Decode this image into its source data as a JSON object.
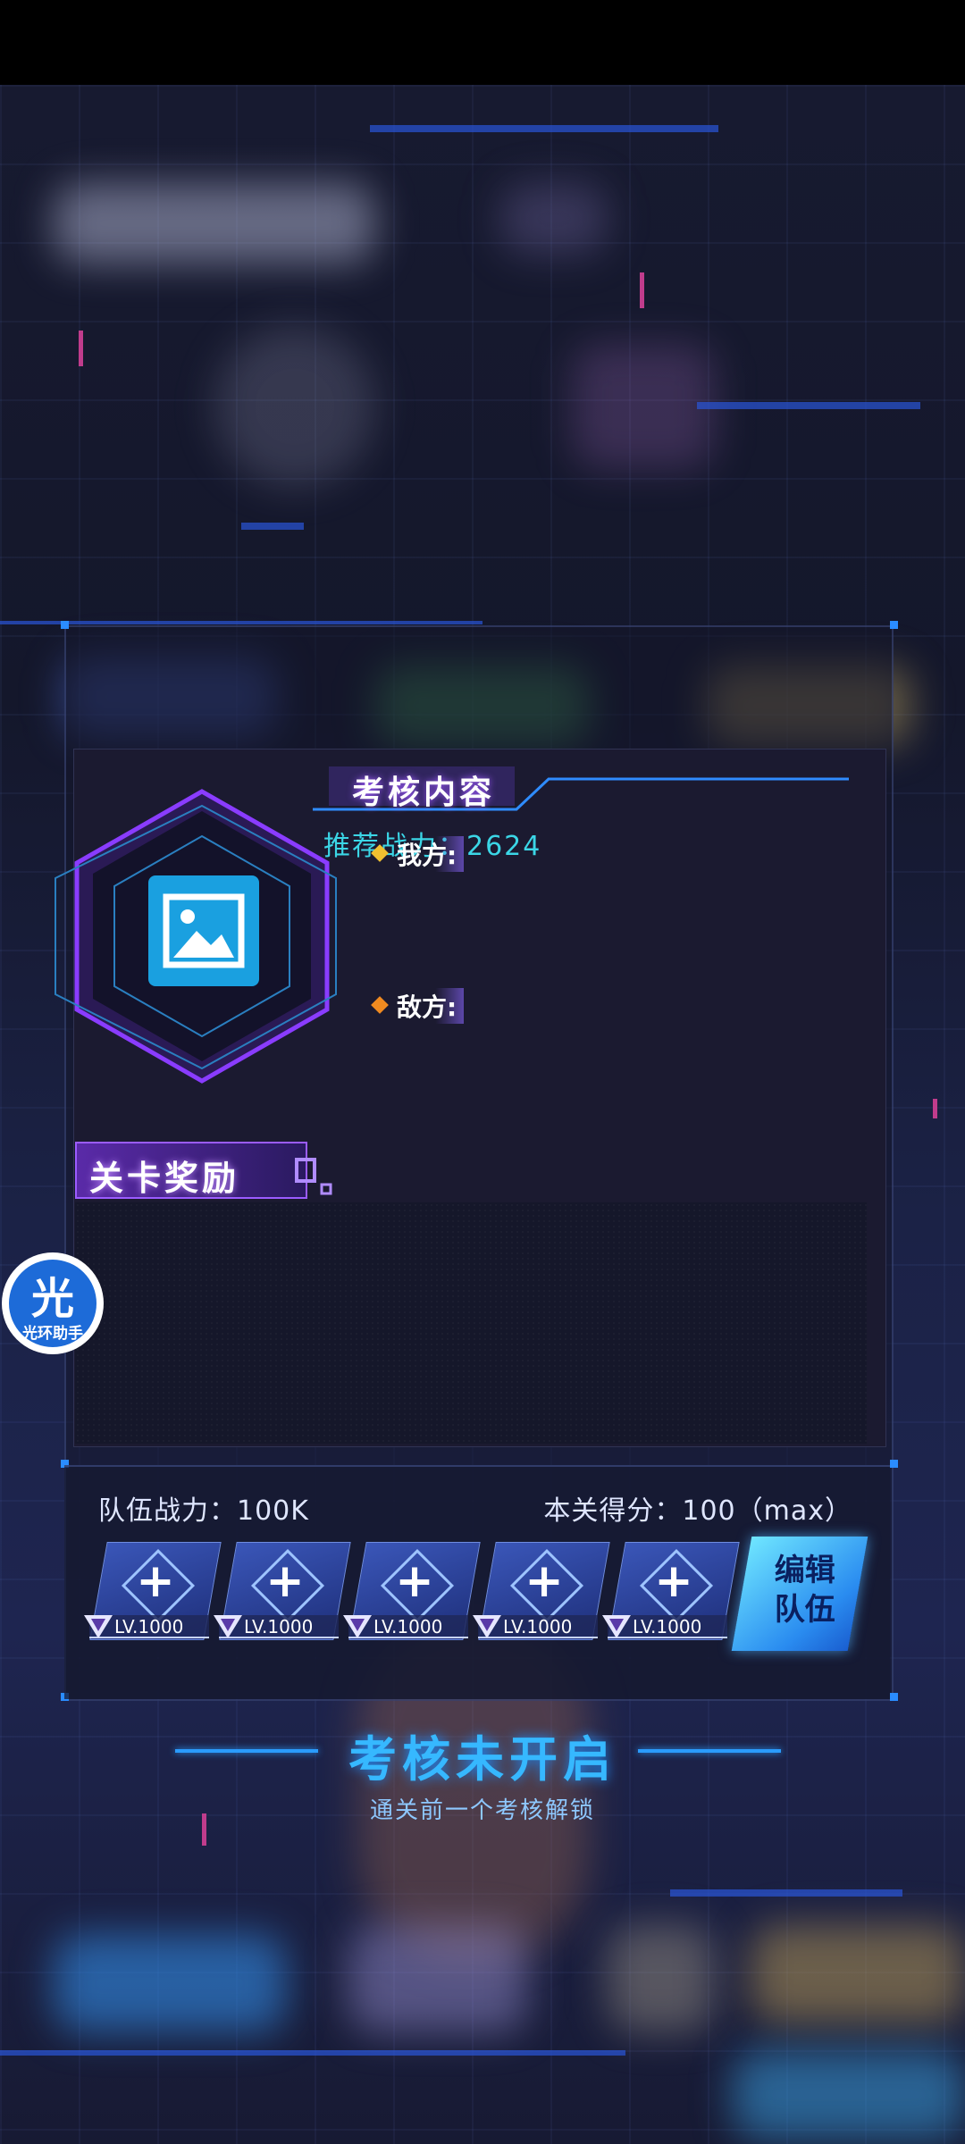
{
  "colors": {
    "accent": "#36b8ff",
    "purple": "#9b5cff",
    "cyan_text": "#3bd6e6",
    "edit_button": "#2a8cf0"
  },
  "content": {
    "title": "考核内容",
    "recommended_power": "推荐战力：2624",
    "ally_label": "我方:",
    "enemy_label": "敌方:",
    "portrait_icon": "image-placeholder-icon"
  },
  "rewards": {
    "title": "关卡奖励"
  },
  "team": {
    "power_text": "队伍战力：100K",
    "score_text": "本关得分：100（max）",
    "slots": [
      {
        "level": "LV.1000",
        "icon": "plus-icon"
      },
      {
        "level": "LV.1000",
        "icon": "plus-icon"
      },
      {
        "level": "LV.1000",
        "icon": "plus-icon"
      },
      {
        "level": "LV.1000",
        "icon": "plus-icon"
      },
      {
        "level": "LV.1000",
        "icon": "plus-icon"
      }
    ],
    "edit_button": "编辑队伍"
  },
  "exam": {
    "status": "考核未开启",
    "hint": "通关前一个考核解锁"
  },
  "floating_helper": {
    "glyph": "光",
    "label": "光环助手"
  }
}
